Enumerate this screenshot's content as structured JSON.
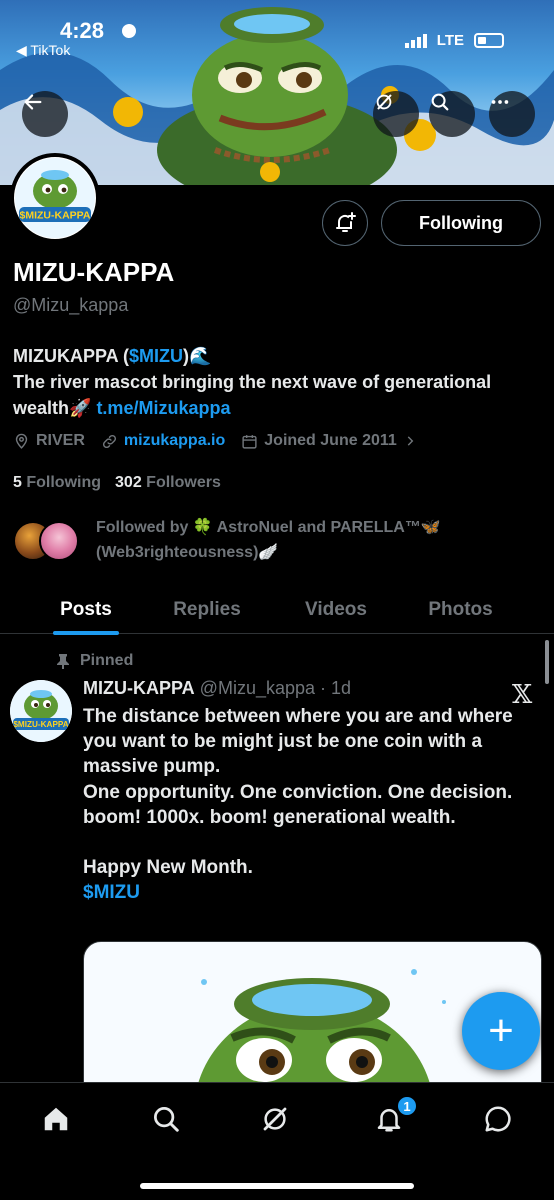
{
  "status_bar": {
    "time": "4:28",
    "back_app": "◀ TikTok",
    "network": "LTE"
  },
  "profile": {
    "display_name": "MIZU-KAPPA",
    "handle": "@Mizu_kappa",
    "avatar_text": "$MIZU-KAPPA",
    "following_button": "Following",
    "bio_line1_prefix": "MIZUKAPPA (",
    "bio_cashtag": "$MIZU",
    "bio_line1_suffix": ")🌊",
    "bio_line2": "The river mascot bringing the next wave of generational wealth🚀 ",
    "bio_link": "t.me/Mizukappa",
    "location": "RIVER",
    "website": "mizukappa.io",
    "joined": "Joined June 2011",
    "following_count": "5",
    "following_label": "Following",
    "followers_count": "302",
    "followers_label": "Followers",
    "followed_by": "Followed by 🍀 AstroNuel and PARELLA™🦋 (Web3righteousness)🪽"
  },
  "tabs": [
    {
      "label": "Posts",
      "active": true
    },
    {
      "label": "Replies",
      "active": false
    },
    {
      "label": "Videos",
      "active": false
    },
    {
      "label": "Photos",
      "active": false
    }
  ],
  "post": {
    "pinned_label": "Pinned",
    "author": "MIZU-KAPPA",
    "handle_time": "@Mizu_kappa · 1d",
    "avatar_text": "$MIZU-KAPPA",
    "x_logo": "𝕏",
    "body": "The distance between where you are and where you want to be might just be one coin with a massive pump.\nOne opportunity. One conviction. One decision. boom! 1000x. boom! generational wealth.\n\nHappy New Month.",
    "cashtag": "$MIZU"
  },
  "fab": {
    "label": "+"
  },
  "bottom_nav": {
    "notifications_badge": "1"
  },
  "colors": {
    "accent": "#1d9bf0",
    "background": "#000000",
    "muted": "#71767b"
  },
  "icons": [
    "back-arrow-icon",
    "grok-icon",
    "search-icon",
    "more-icon",
    "bell-plus-icon",
    "location-icon",
    "link-icon",
    "calendar-icon",
    "chevron-right-icon",
    "pin-icon",
    "home-icon",
    "search-nav-icon",
    "grok-nav-icon",
    "bell-icon",
    "messages-icon"
  ]
}
